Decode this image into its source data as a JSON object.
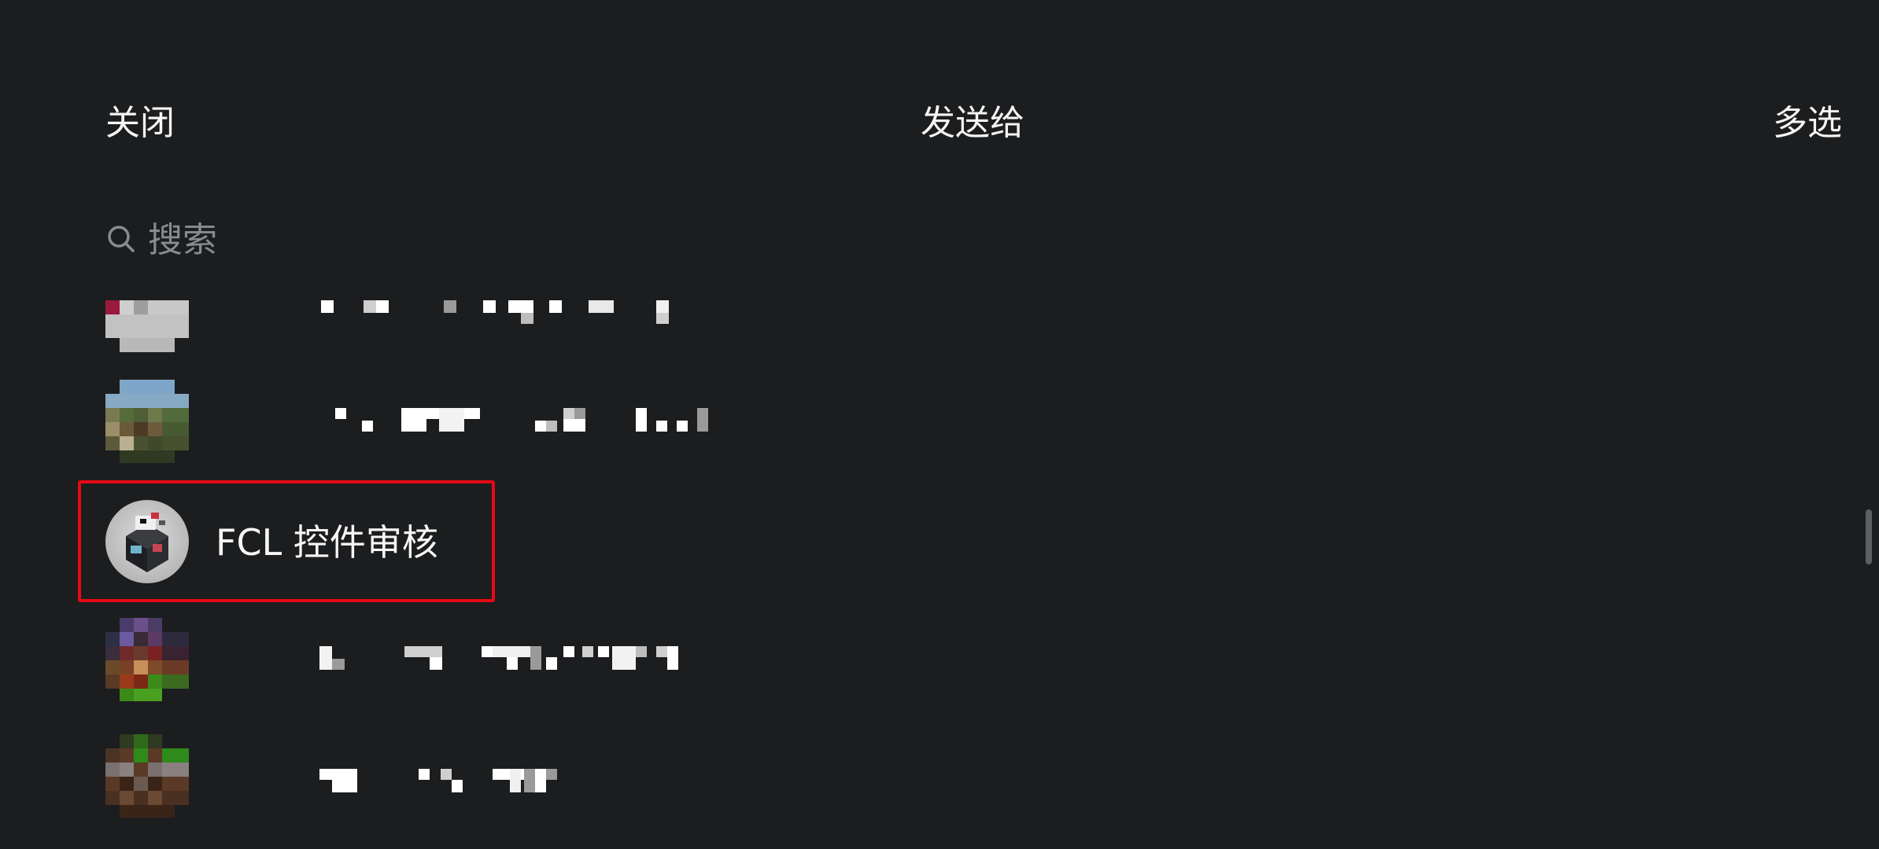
{
  "header": {
    "close_label": "关闭",
    "title": "发送给",
    "multi_select_label": "多选"
  },
  "search": {
    "placeholder": "搜索"
  },
  "contacts": [
    {
      "name": "",
      "redacted": true
    },
    {
      "name": "",
      "redacted": true
    },
    {
      "name": "FCL 控件审核",
      "highlighted": true
    },
    {
      "name": "",
      "redacted": true
    },
    {
      "name": "",
      "redacted": true
    }
  ],
  "colors": {
    "background": "#1c1d1f",
    "text": "#f2f2f2",
    "placeholder": "#8a8b8d",
    "highlight_border": "#e50914"
  }
}
